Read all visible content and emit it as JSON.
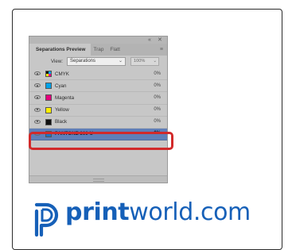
{
  "panel": {
    "tabs": [
      "Separations Preview",
      "Trap",
      "Flatt"
    ],
    "tab_menu_icon": "menu-icon",
    "topbar_icons": [
      "collapse-icon",
      "close-icon"
    ],
    "view_label": "View:",
    "view_value": "Separations",
    "zoom_value": "100%",
    "rows": [
      {
        "label": "CMYK",
        "pct": "0%",
        "swatch": "cmyk",
        "color": ""
      },
      {
        "label": "Cyan",
        "pct": "0%",
        "swatch": "solid",
        "color": "#00a2e8"
      },
      {
        "label": "Magenta",
        "pct": "0%",
        "swatch": "solid",
        "color": "#e4007c"
      },
      {
        "label": "Yellow",
        "pct": "0%",
        "swatch": "solid",
        "color": "#ffee00"
      },
      {
        "label": "Black",
        "pct": "0%",
        "swatch": "solid",
        "color": "#111111"
      },
      {
        "label": "PANTONE 300 U",
        "pct": "0%",
        "swatch": "solid",
        "color": "#1a73c5",
        "selected": true
      }
    ]
  },
  "highlight_color": "#d22a2a",
  "logo": {
    "prefix": "print",
    "suffix": "world.com",
    "color": "#1660b8"
  }
}
